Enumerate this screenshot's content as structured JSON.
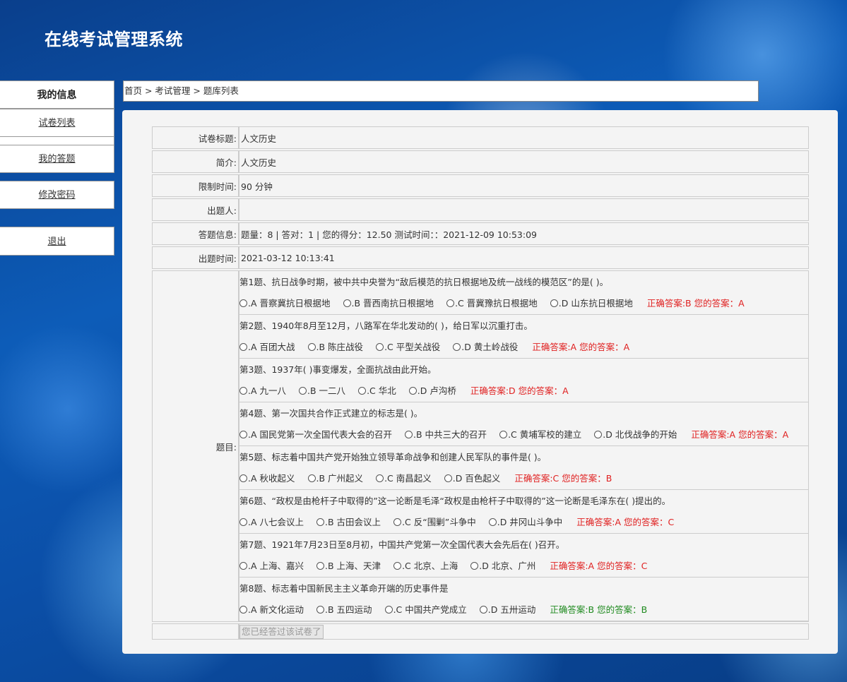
{
  "app": {
    "title": "在线考试管理系统"
  },
  "sidebar": {
    "header": "我的信息",
    "items": [
      {
        "label": "试卷列表"
      },
      {
        "label": "我的答题"
      },
      {
        "label": "修改密码"
      }
    ],
    "logout": "退出"
  },
  "breadcrumb": "首页 > 考试管理 > 题库列表",
  "exam": {
    "title_label": "试卷标题:",
    "title": "人文历史",
    "intro_label": "简介:",
    "intro": "人文历史",
    "time_label": "限制时间:",
    "time": "90 分钟",
    "author_label": "出题人:",
    "author": "",
    "result_label": "答题信息:",
    "result": "题量：8 | 答对：1 | 您的得分：12.50 测试时间：：2021-12-09 10:53:09",
    "created_label": "出题时间:",
    "created": "2021-03-12 10:13:41",
    "questions_label": "题目:",
    "button": "您已经答过该试卷了"
  },
  "questions": [
    {
      "title": "第1题、抗日战争时期，被中共中央誉为“敌后模范的抗日根据地及统一战线的模范区”的是( )。",
      "options": [
        "A 晋察冀抗日根据地",
        "B 晋西南抗日根据地",
        "C 晋冀豫抗日根据地",
        "D 山东抗日根据地"
      ],
      "answer": "正确答案:B 您的答案：A"
    },
    {
      "title": "第2题、1940年8月至12月，八路军在华北发动的( )，给日军以沉重打击。",
      "options": [
        "A 百团大战",
        "B 陈庄战役",
        "C 平型关战役",
        "D 黄土岭战役"
      ],
      "answer": "正确答案:A 您的答案：A"
    },
    {
      "title": "第3题、1937年( )事变爆发，全面抗战由此开始。",
      "options": [
        "A 九一八",
        "B 一二八",
        "C 华北",
        "D 卢沟桥"
      ],
      "answer": "正确答案:D 您的答案：A"
    },
    {
      "title": "第4题、第一次国共合作正式建立的标志是( )。",
      "options": [
        "A 国民党第一次全国代表大会的召开",
        "B 中共三大的召开",
        "C 黄埔军校的建立",
        "D 北伐战争的开始"
      ],
      "answer": "正确答案:A 您的答案：A"
    },
    {
      "title": "第5题、标志着中国共产党开始独立领导革命战争和创建人民军队的事件是( )。",
      "options": [
        "A 秋收起义",
        "B 广州起义",
        "C 南昌起义",
        "D 百色起义"
      ],
      "answer": "正确答案:C 您的答案：B"
    },
    {
      "title": "第6题、“政权是由枪杆子中取得的”这一论断是毛泽“政权是由枪杆子中取得的”这一论断是毛泽东在( )提出的。",
      "options": [
        "A 八七会议上",
        "B 古田会议上",
        "C 反“围剿”斗争中",
        "D 井冈山斗争中"
      ],
      "answer": "正确答案:A 您的答案：C"
    },
    {
      "title": "第7题、1921年7月23日至8月初，中国共产党第一次全国代表大会先后在( )召开。",
      "options": [
        "A 上海、嘉兴",
        "B 上海、天津",
        "C 北京、上海",
        "D 北京、广州"
      ],
      "answer": "正确答案:A 您的答案：C"
    },
    {
      "title": "第8题、标志着中国新民主主义革命开端的历史事件是",
      "options": [
        "A 新文化运动",
        "B 五四运动",
        "C 中国共产党成立",
        "D 五卅运动"
      ],
      "answer": "正确答案:B 您的答案：B",
      "answer_color": "#1f8a1f"
    }
  ],
  "colors": {
    "wrong": "#e02020",
    "right": "#1f8a1f"
  }
}
